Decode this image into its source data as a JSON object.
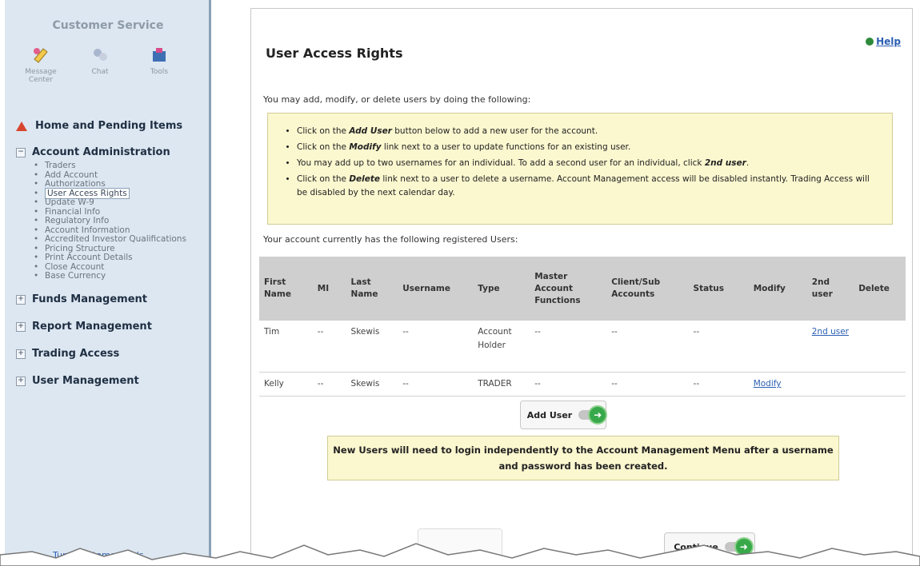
{
  "sidebar": {
    "title": "Customer Service",
    "icons": [
      {
        "label": "Message Center",
        "icon": "message-center-icon"
      },
      {
        "label": "Chat",
        "icon": "chat-icon"
      },
      {
        "label": "Tools",
        "icon": "tools-icon"
      }
    ],
    "home": "Home and Pending Items",
    "account_admin": {
      "label": "Account Administration",
      "items": [
        "Traders",
        "Add Account",
        "Authorizations",
        "User Access Rights",
        "Update W-9",
        "Financial Info",
        "Regulatory Info",
        "Account Information",
        "Accredited Investor Qualifications",
        "Pricing Structure",
        "Print Account Details",
        "Close Account",
        "Base Currency"
      ]
    },
    "sections": [
      "Funds Management",
      "Report Management",
      "Trading Access",
      "User Management"
    ],
    "bottom_link": "Tur... Customer Tools"
  },
  "main": {
    "help": "Help",
    "title": "User Access Rights",
    "intro": "You may add, modify, or delete users by doing the following:",
    "bullets": [
      {
        "pre": "Click on the ",
        "bold": "Add User",
        "post": " button below to add a new user for the account."
      },
      {
        "pre": "Click on the ",
        "bold": "Modify",
        "post": " link next to a user to update functions for an existing user."
      },
      {
        "pre": "You may add up to two usernames for an individual. To add a second user for an individual, click ",
        "bold": "2nd user",
        "post": "."
      },
      {
        "pre": "Click on the ",
        "bold": "Delete",
        "post": " link next to a user to delete a username. Account Management access will be disabled instantly. Trading Access will be disabled by the next calendar day."
      }
    ],
    "registered_text": "Your account currently has the following registered Users:",
    "table": {
      "headers": [
        "First Name",
        "MI",
        "Last Name",
        "Username",
        "Type",
        "Master Account Functions",
        "Client/Sub Accounts",
        "Status",
        "Modify",
        "2nd user",
        "Delete"
      ],
      "rows": [
        {
          "first": "Tim",
          "mi": "--",
          "last": "Skewis",
          "username": "--",
          "type": "Account Holder",
          "master": "--",
          "client": "--",
          "status": "--",
          "modify": "",
          "second_user": "2nd user",
          "delete": ""
        },
        {
          "first": "Kelly",
          "mi": "--",
          "last": "Skewis",
          "username": "--",
          "type": "TRADER",
          "master": "--",
          "client": "--",
          "status": "--",
          "modify": "Modify",
          "second_user": "",
          "delete": ""
        }
      ]
    },
    "add_user_label": "Add User",
    "notice": "New Users will need to login independently to the Account Management Menu after a username and password has been created.",
    "continue_label": "Continue"
  },
  "colors": {
    "sidebar_bg": "#dde7f1",
    "info_bg": "#fbf7cf",
    "link": "#2b5fb3",
    "table_header": "#cfcfcf",
    "go_green": "#38a94a"
  }
}
